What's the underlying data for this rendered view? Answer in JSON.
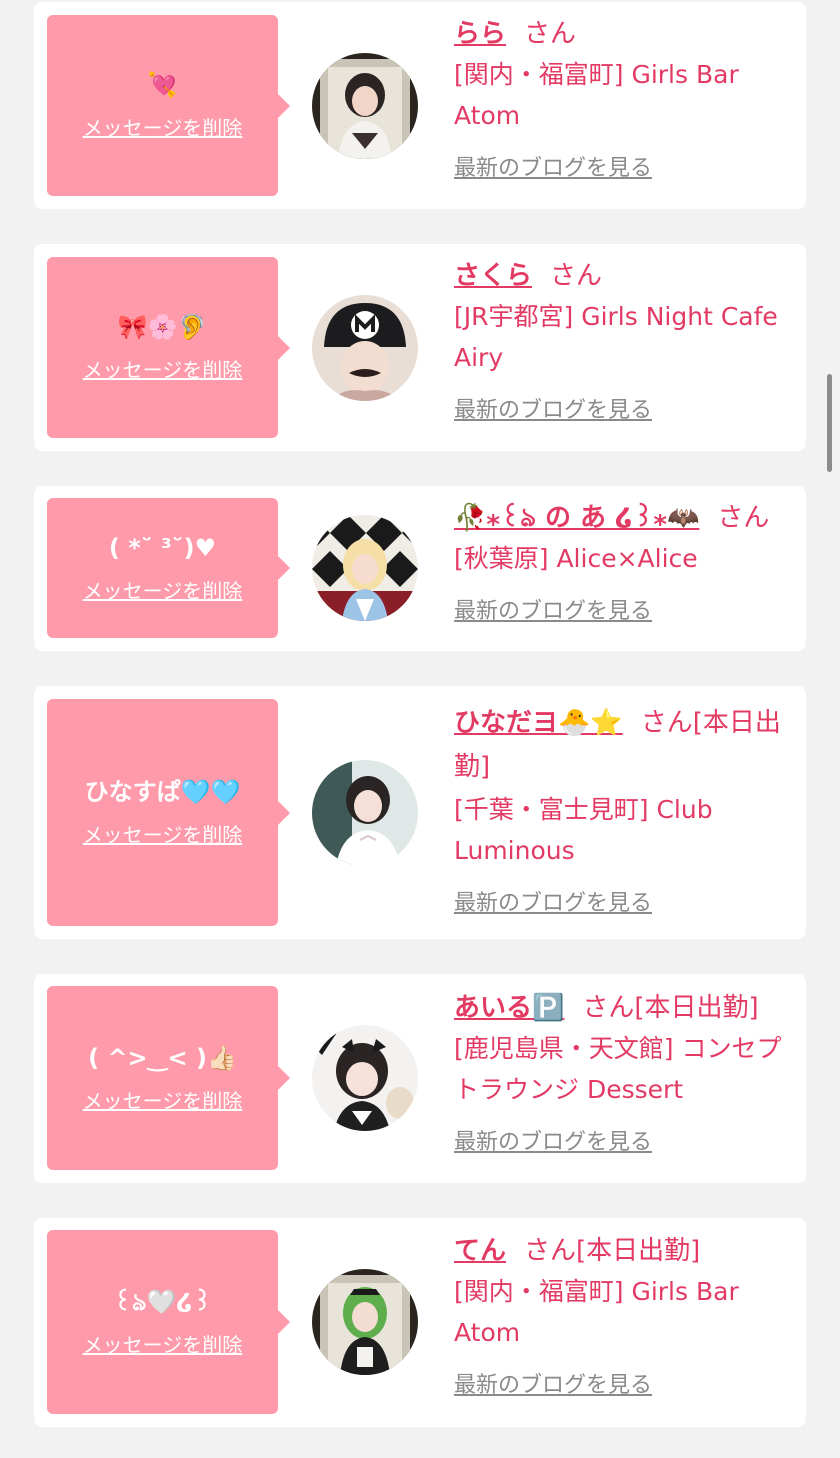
{
  "cards": [
    {
      "message": "💘",
      "delete_label": "メッセージを削除",
      "name": "らら",
      "honorific": "さん",
      "shop": "[関内・福富町] Girls Bar Atom",
      "blog_label": "最新のブログを見る"
    },
    {
      "message": "🎀🌸🦻",
      "delete_label": "メッセージを削除",
      "name": "さくら",
      "honorific": "さん",
      "shop": "[JR宇都宮] Girls Night Cafe Airy",
      "blog_label": "最新のブログを見る"
    },
    {
      "message": "( *˘ ³˘)♥",
      "delete_label": "メッセージを削除",
      "name": "🥀⁎꒰ঌ の あ ໒꒱⁎🦇",
      "honorific": "さん",
      "shop": "[秋葉原] Alice×Alice",
      "blog_label": "最新のブログを見る"
    },
    {
      "message": "ひなすぱ🩵🩵",
      "delete_label": "メッセージを削除",
      "name": "ひなだヨ🐣⭐️",
      "honorific": "さん[本日出勤]",
      "shop": "[千葉・富士見町] Club Luminous",
      "blog_label": "最新のブログを見る"
    },
    {
      "message": "( ^>‿< )👍🏻",
      "delete_label": "メッセージを削除",
      "name": "あいる🅿️",
      "honorific": "さん[本日出勤]",
      "shop": "[鹿児島県・天文館] コンセプトラウンジ Dessert",
      "blog_label": "最新のブログを見る"
    },
    {
      "message": "꒰ঌ🤍໒꒱",
      "delete_label": "メッセージを削除",
      "name": "てん",
      "honorific": "さん[本日出勤]",
      "shop": "[関内・福富町] Girls Bar Atom",
      "blog_label": "最新のブログを見る"
    }
  ],
  "colors": {
    "background": "#f2f2f2",
    "card": "#ffffff",
    "bubble": "#ff9aaa",
    "accent": "#e33a64",
    "muted_link": "#8a8a8a"
  }
}
